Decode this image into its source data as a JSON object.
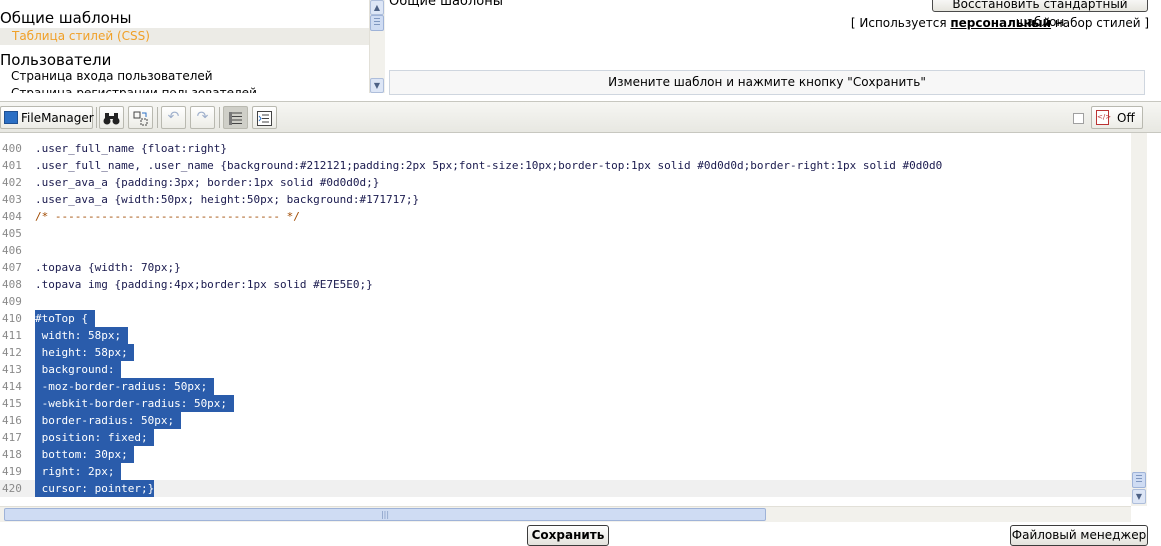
{
  "templates": {
    "categories": [
      {
        "label": "Общие шаблоны"
      },
      {
        "label": "Пользователи"
      }
    ],
    "items": [
      {
        "label": "Таблица стилей (CSS)",
        "selected": true
      },
      {
        "label": "Страница входа пользователей"
      },
      {
        "label": "Страница регистрации пользователей"
      }
    ]
  },
  "panel": {
    "title": "Общие шаблоны",
    "restore_button": "Восстановить стандартный шаблон",
    "notice_prefix": "[ Используется ",
    "notice_bold": "персональный",
    "notice_suffix": " набор стилей ]",
    "hint": "Измените шаблон и нажмите кнопку \"Сохранить\""
  },
  "toolbar": {
    "filemanager_label": "FileManager",
    "toggle_label": "Off",
    "icons": [
      "filemanager-icon",
      "search-binoculars-icon",
      "replace-icon",
      "undo-icon",
      "redo-icon",
      "line-numbers-icon",
      "word-wrap-icon",
      "highlight-icon"
    ]
  },
  "editor": {
    "lines": [
      {
        "n": "400",
        "text": ".user_full_name {float:right}"
      },
      {
        "n": "401",
        "text": ".user_full_name, .user_name {background:#212121;padding:2px 5px;font-size:10px;border-top:1px solid #0d0d0d;border-right:1px solid #0d0d0"
      },
      {
        "n": "402",
        "text": ".user_ava_a {padding:3px; border:1px solid #0d0d0d;}"
      },
      {
        "n": "403",
        "text": ".user_ava_a {width:50px; height:50px; background:#171717;}"
      },
      {
        "n": "404",
        "text": "/* ---------------------------------- */",
        "type": "comment"
      },
      {
        "n": "405",
        "text": ""
      },
      {
        "n": "406",
        "text": ""
      },
      {
        "n": "407",
        "text": ".topava {width: 70px;}"
      },
      {
        "n": "408",
        "text": ".topava img {padding:4px;border:1px solid #E7E5E0;}"
      },
      {
        "n": "409",
        "text": ""
      },
      {
        "n": "410",
        "text": "#toTop { ",
        "type": "hl"
      },
      {
        "n": "411",
        "text": " width: 58px; ",
        "type": "hl"
      },
      {
        "n": "412",
        "text": " height: 58px; ",
        "type": "hl"
      },
      {
        "n": "413",
        "text": " background: ",
        "type": "hl"
      },
      {
        "n": "414",
        "text": " -moz-border-radius: 50px; ",
        "type": "hl"
      },
      {
        "n": "415",
        "text": " -webkit-border-radius: 50px; ",
        "type": "hl"
      },
      {
        "n": "416",
        "text": " border-radius: 50px; ",
        "type": "hl"
      },
      {
        "n": "417",
        "text": " position: fixed; ",
        "type": "hl"
      },
      {
        "n": "418",
        "text": " bottom: 30px; ",
        "type": "hl"
      },
      {
        "n": "419",
        "text": " right: 2px; ",
        "type": "hl"
      },
      {
        "n": "420",
        "text": " cursor: pointer;}",
        "type": "hl",
        "active": true
      }
    ]
  },
  "bottom": {
    "save_button": "Сохранить",
    "filemanager_button": "Файловый менеджер"
  }
}
